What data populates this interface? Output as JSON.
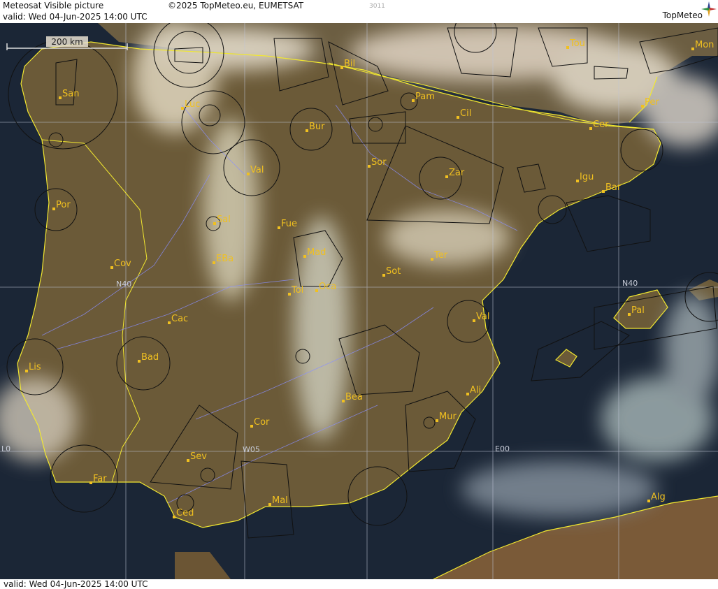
{
  "header": {
    "title": "Meteosat Visible picture",
    "copyright": "©2025 TopMeteo.eu, EUMETSAT",
    "code": "3011",
    "valid": "valid:  Wed  04-Jun-2025  14:00 UTC",
    "logo": "TopMeteo"
  },
  "footer": {
    "valid": "valid:  Wed  04-Jun-2025  14:00 UTC"
  },
  "scale": {
    "label": "200 km"
  },
  "grid_labels": {
    "n40_left": "N40",
    "n40_right": "N40",
    "w05": "W05",
    "e00": "E00",
    "l0": "L0"
  },
  "cities": [
    {
      "name": "San"
    },
    {
      "name": "Bil"
    },
    {
      "name": "Tou"
    },
    {
      "name": "Mon"
    },
    {
      "name": "Luc"
    },
    {
      "name": "Pam"
    },
    {
      "name": "Cil"
    },
    {
      "name": "Per"
    },
    {
      "name": "Bur"
    },
    {
      "name": "Cer"
    },
    {
      "name": "Val"
    },
    {
      "name": "Sor"
    },
    {
      "name": "Zar"
    },
    {
      "name": "Igu"
    },
    {
      "name": "Bar"
    },
    {
      "name": "Por"
    },
    {
      "name": "Sal"
    },
    {
      "name": "Fue"
    },
    {
      "name": "Mad"
    },
    {
      "name": "Cov"
    },
    {
      "name": "EBa"
    },
    {
      "name": "Ter"
    },
    {
      "name": "Sot"
    },
    {
      "name": "Tol"
    },
    {
      "name": "Oca"
    },
    {
      "name": "Pal"
    },
    {
      "name": "Cac"
    },
    {
      "name": "Val"
    },
    {
      "name": "Bad"
    },
    {
      "name": "Lis"
    },
    {
      "name": "Ali"
    },
    {
      "name": "Bea"
    },
    {
      "name": "Mur"
    },
    {
      "name": "Cor"
    },
    {
      "name": "Sev"
    },
    {
      "name": "Far"
    },
    {
      "name": "Mal"
    },
    {
      "name": "Ced"
    },
    {
      "name": "Alg"
    }
  ],
  "colors": {
    "label": "#f0c020",
    "coast": "#f2e830",
    "land": "#6b5a3a",
    "sea": "#1a2535",
    "river": "#8a8fff"
  }
}
